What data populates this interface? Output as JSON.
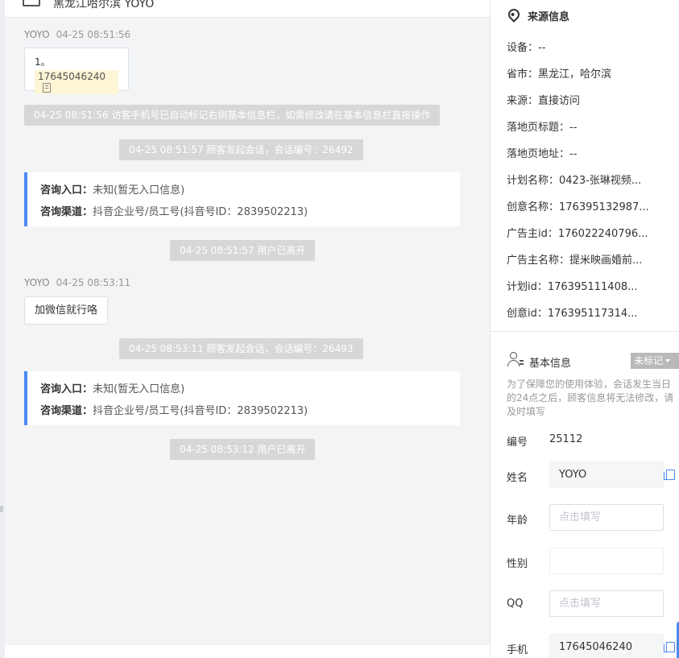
{
  "header": {
    "title": "黑龙江哈尔滨  YOYO"
  },
  "chat": {
    "messages": [
      {
        "sender": "YOYO",
        "time": "04-25 08:51:56",
        "line1": "1。",
        "phone": "17645046240"
      }
    ],
    "system1": "04-25 08:51:56 访客手机号已自动标记右侧基本信息栏，如需修改请在基本信息栏直接操作",
    "system2": "04-25 08:51:57 顾客发起会话，会话编号：26492",
    "consult1": {
      "entry_label": "咨询入口：",
      "entry_value": "未知(暂无入口信息)",
      "channel_label": "咨询渠道：",
      "channel_value": "抖音企业号/员工号(抖音号ID：2839502213)"
    },
    "system3": "04-25 08:51:57 用户已离开",
    "message2": {
      "sender": "YOYO",
      "time": "04-25 08:53:11",
      "text": "加微信就行咯"
    },
    "system4": "04-25 08:53:11 顾客发起会话，会话编号：26493",
    "consult2": {
      "entry_label": "咨询入口：",
      "entry_value": "未知(暂无入口信息)",
      "channel_label": "咨询渠道：",
      "channel_value": "抖音企业号/员工号(抖音号ID：2839502213)"
    },
    "system5": "04-25 08:53:12 用户已离开"
  },
  "source": {
    "title": "来源信息",
    "rows": [
      "设备：--",
      "省市：黑龙江，哈尔滨",
      "来源：直接访问",
      "落地页标题：--",
      "落地页地址：--",
      "计划名称：0423-张琳视频...",
      "创意名称：176395132987...",
      "广告主id：176022240796...",
      "广告主名称：提米映画婚前...",
      "计划id：176395111408...",
      "创意id：176395117314..."
    ]
  },
  "basic": {
    "title": "基本信息",
    "mark_label": "未标记",
    "note": "为了保障您的使用体验，会话发生当日的24点之后，顾客信息将无法修改，请及时填写",
    "id_label": "编号",
    "id_value": "25112",
    "name_label": "姓名",
    "name_value": "YOYO",
    "age_label": "年龄",
    "age_placeholder": "点击填写",
    "gender_label": "性别",
    "qq_label": "QQ",
    "qq_placeholder": "点击填写",
    "phone_label": "手机",
    "phone_value": "17645046240"
  },
  "colors": {
    "accent": "#4a8af4",
    "system_bg": "#d6d7d9",
    "highlight": "#fdf5d5"
  }
}
